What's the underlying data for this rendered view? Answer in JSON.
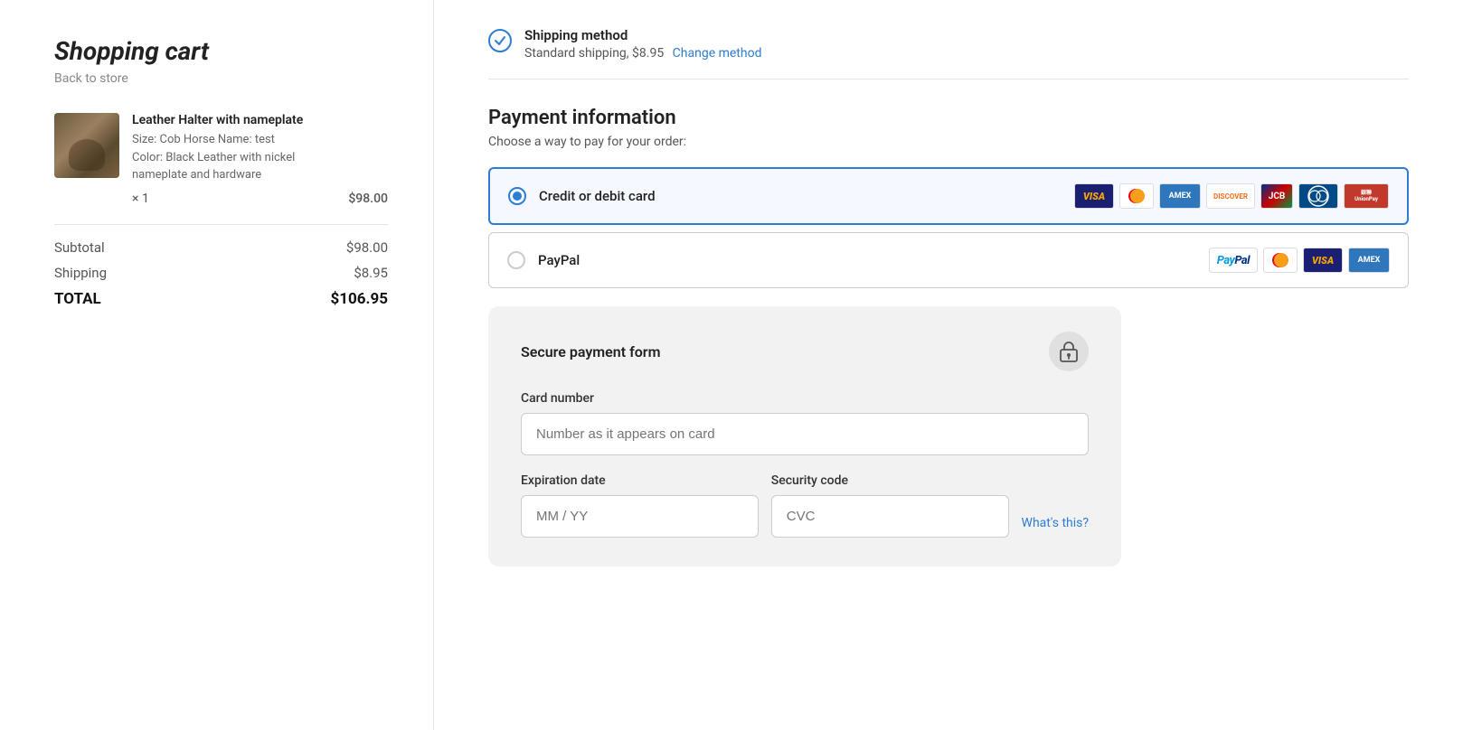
{
  "left": {
    "title": "Shopping cart",
    "back_link": "Back to store",
    "item": {
      "name": "Leather Halter with nameplate",
      "description_line1": "Size: Cob  Horse Name: test",
      "description_line2": "Color: Black Leather with nickel",
      "description_line3": "nameplate and hardware",
      "quantity": "× 1",
      "price": "$98.00"
    },
    "subtotal_label": "Subtotal",
    "subtotal_value": "$98.00",
    "shipping_label": "Shipping",
    "shipping_value": "$8.95",
    "total_label": "TOTAL",
    "total_value": "$106.95"
  },
  "right": {
    "shipping": {
      "label": "Shipping method",
      "detail": "Standard shipping, $8.95",
      "change_link": "Change method"
    },
    "payment": {
      "title": "Payment information",
      "subtitle": "Choose a way to pay for your order:",
      "options": [
        {
          "id": "credit-card",
          "label": "Credit or debit card",
          "selected": true
        },
        {
          "id": "paypal",
          "label": "PayPal",
          "selected": false
        }
      ]
    },
    "form": {
      "title": "Secure payment form",
      "card_number_label": "Card number",
      "card_number_placeholder": "Number as it appears on card",
      "expiry_label": "Expiration date",
      "expiry_placeholder": "MM / YY",
      "cvc_label": "Security code",
      "cvc_placeholder": "CVC",
      "whats_this": "What's this?"
    }
  }
}
